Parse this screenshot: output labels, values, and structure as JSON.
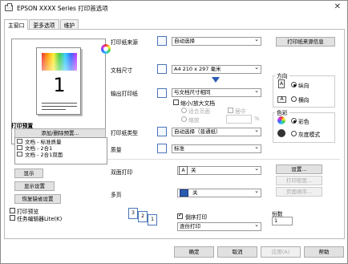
{
  "window": {
    "title": "EPSON  XXXX  Series 打印首选项",
    "close": "✕"
  },
  "tabs": [
    "主窗口",
    "更多选项",
    "维护"
  ],
  "preview": {
    "page_number": "1"
  },
  "left": {
    "section_title": "打印预置",
    "add_delete_label": "添加/删除预置...",
    "presets": [
      "文档 - 标准质量",
      "文档 - 2合1",
      "文档 - 2合1双面"
    ],
    "show_settings": "显示",
    "show_settings_label": "显示设置",
    "restore_defaults": "恢复缺省设置",
    "preview_checkbox": "打印预览",
    "job_arranger_checkbox": "任务编辑器Lite(K)"
  },
  "form": {
    "source_label": "打印纸来源",
    "source_value": "自动选择",
    "source_info_button": "打印纸来源信息",
    "size_label": "文档尺寸",
    "size_value": "A4 210 x 297 毫米",
    "output_label": "输出打印纸",
    "output_value": "与文档尺寸相同",
    "shrink_label": "缩小/放大文档",
    "fit_page_label": "适合页面",
    "scale_label": "缩放",
    "zoom_label": "适合",
    "center_label": "居中",
    "percent": "%",
    "type_label": "打印纸类型",
    "type_value": "自动选择（普通纸）",
    "quality_label": "质量",
    "quality_value": "标准",
    "orientation_title": "方向",
    "portrait_label": "纵向",
    "landscape_label": "横向",
    "color_title": "色彩",
    "color_label": "彩色",
    "grayscale_label": "灰度模式",
    "duplex_label": "双面打印",
    "duplex_value": "关",
    "settings_button": "设置...",
    "print_density_button": "打印密度...",
    "page_order_button": "页面顺序...",
    "multipage_label": "多页",
    "multipage_value": "关",
    "reverse_order_label": "倒序打印",
    "collate_value": "逐份打印",
    "copies_label": "份数",
    "copies_value": "1"
  },
  "footer": {
    "ok": "确定",
    "cancel": "取消",
    "apply": "应用(A)",
    "help": "帮助"
  }
}
